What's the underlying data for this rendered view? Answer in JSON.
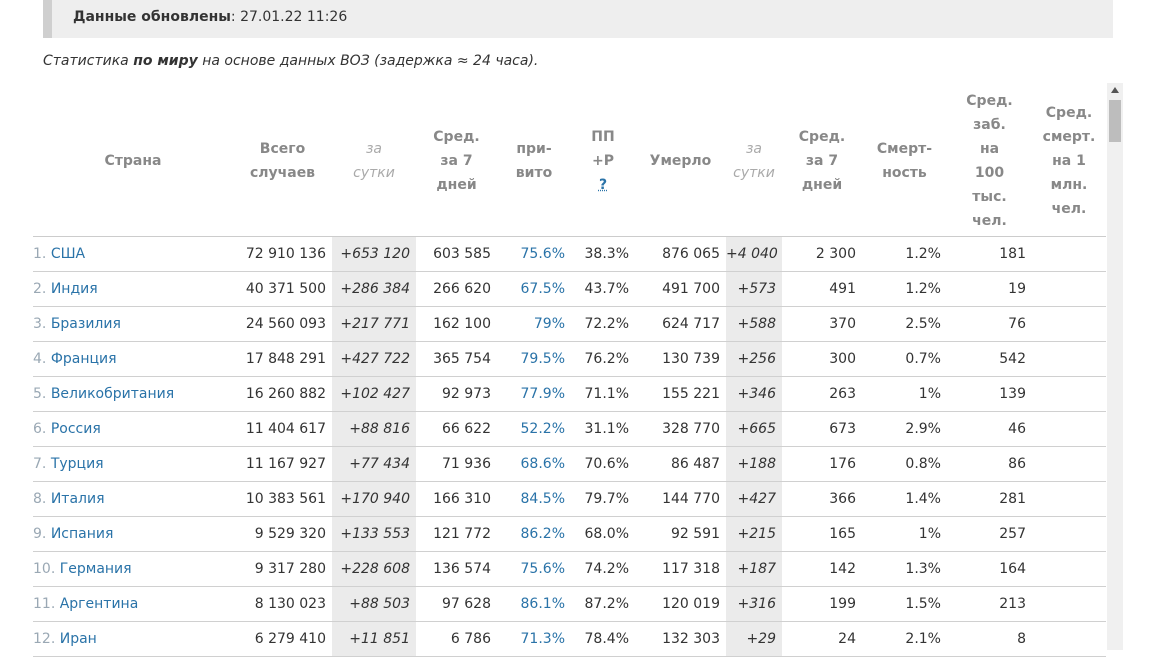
{
  "update": {
    "label": "Данные обновлены",
    "value": "27.01.22 11:26"
  },
  "subtitle": {
    "part1": "Статистика ",
    "bold": "по миру",
    "part2": " на основе данных ВОЗ (задержка ≈ 24 часа)."
  },
  "headers": {
    "country": "Страна",
    "total": [
      "Всего",
      "случаев"
    ],
    "day_cases": [
      "за",
      "сутки"
    ],
    "avg_cases": [
      "Сред.",
      "за 7",
      "дней"
    ],
    "vaccinated": [
      "при-",
      "вито"
    ],
    "pp": [
      "ПП",
      "+Р"
    ],
    "pp_help": "?",
    "deaths": "Умерло",
    "day_deaths": [
      "за",
      "сутки"
    ],
    "avg_deaths": [
      "Сред.",
      "за 7",
      "дней"
    ],
    "mortality": [
      "Смерт-",
      "ность"
    ],
    "avg_per100k": [
      "Сред.",
      "заб.",
      "на",
      "100",
      "тыс.",
      "чел."
    ],
    "avg_per1m": [
      "Сред.",
      "смерт.",
      "на 1",
      "млн.",
      "чел."
    ]
  },
  "rows": [
    {
      "n": "1.",
      "country": "США",
      "total": "72 910 136",
      "day": "+653 120",
      "avg": "603 585",
      "vac": "75.6%",
      "pp": "38.3%",
      "deaths": "876 065",
      "dday": "+4 040",
      "davg": "2 300",
      "mort": "1.2%",
      "p100k": "181",
      "p1m": ""
    },
    {
      "n": "2.",
      "country": "Индия",
      "total": "40 371 500",
      "day": "+286 384",
      "avg": "266 620",
      "vac": "67.5%",
      "pp": "43.7%",
      "deaths": "491 700",
      "dday": "+573",
      "davg": "491",
      "mort": "1.2%",
      "p100k": "19",
      "p1m": ""
    },
    {
      "n": "3.",
      "country": "Бразилия",
      "total": "24 560 093",
      "day": "+217 771",
      "avg": "162 100",
      "vac": "79%",
      "pp": "72.2%",
      "deaths": "624 717",
      "dday": "+588",
      "davg": "370",
      "mort": "2.5%",
      "p100k": "76",
      "p1m": ""
    },
    {
      "n": "4.",
      "country": "Франция",
      "total": "17 848 291",
      "day": "+427 722",
      "avg": "365 754",
      "vac": "79.5%",
      "pp": "76.2%",
      "deaths": "130 739",
      "dday": "+256",
      "davg": "300",
      "mort": "0.7%",
      "p100k": "542",
      "p1m": ""
    },
    {
      "n": "5.",
      "country": "Великобритания",
      "total": "16 260 882",
      "day": "+102 427",
      "avg": "92 973",
      "vac": "77.9%",
      "pp": "71.1%",
      "deaths": "155 221",
      "dday": "+346",
      "davg": "263",
      "mort": "1%",
      "p100k": "139",
      "p1m": ""
    },
    {
      "n": "6.",
      "country": "Россия",
      "total": "11 404 617",
      "day": "+88 816",
      "avg": "66 622",
      "vac": "52.2%",
      "pp": "31.1%",
      "deaths": "328 770",
      "dday": "+665",
      "davg": "673",
      "mort": "2.9%",
      "p100k": "46",
      "p1m": ""
    },
    {
      "n": "7.",
      "country": "Турция",
      "total": "11 167 927",
      "day": "+77 434",
      "avg": "71 936",
      "vac": "68.6%",
      "pp": "70.6%",
      "deaths": "86 487",
      "dday": "+188",
      "davg": "176",
      "mort": "0.8%",
      "p100k": "86",
      "p1m": ""
    },
    {
      "n": "8.",
      "country": "Италия",
      "total": "10 383 561",
      "day": "+170 940",
      "avg": "166 310",
      "vac": "84.5%",
      "pp": "79.7%",
      "deaths": "144 770",
      "dday": "+427",
      "davg": "366",
      "mort": "1.4%",
      "p100k": "281",
      "p1m": ""
    },
    {
      "n": "9.",
      "country": "Испания",
      "total": "9 529 320",
      "day": "+133 553",
      "avg": "121 772",
      "vac": "86.2%",
      "pp": "68.0%",
      "deaths": "92 591",
      "dday": "+215",
      "davg": "165",
      "mort": "1%",
      "p100k": "257",
      "p1m": ""
    },
    {
      "n": "10.",
      "country": "Германия",
      "total": "9 317 280",
      "day": "+228 608",
      "avg": "136 574",
      "vac": "75.6%",
      "pp": "74.2%",
      "deaths": "117 318",
      "dday": "+187",
      "davg": "142",
      "mort": "1.3%",
      "p100k": "164",
      "p1m": ""
    },
    {
      "n": "11.",
      "country": "Аргентина",
      "total": "8 130 023",
      "day": "+88 503",
      "avg": "97 628",
      "vac": "86.1%",
      "pp": "87.2%",
      "deaths": "120 019",
      "dday": "+316",
      "davg": "199",
      "mort": "1.5%",
      "p100k": "213",
      "p1m": ""
    },
    {
      "n": "12.",
      "country": "Иран",
      "total": "6 279 410",
      "day": "+11 851",
      "avg": "6 786",
      "vac": "71.3%",
      "pp": "78.4%",
      "deaths": "132 303",
      "dday": "+29",
      "davg": "24",
      "mort": "2.1%",
      "p100k": "8",
      "p1m": ""
    }
  ]
}
